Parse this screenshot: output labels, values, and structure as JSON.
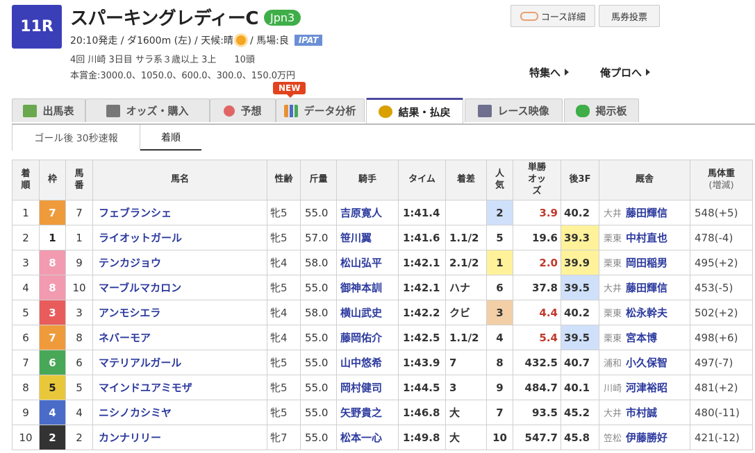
{
  "race": {
    "number": "11R",
    "title": "スパーキングレディーC",
    "grade": "Jpn3",
    "time_course": "20:10発走 / ダ1600m (左) / 天候:晴",
    "track": "/ 馬場:良",
    "ipat": "IPAT",
    "details": "4回 川崎 3日目 サラ系３歳以上 3上　　10頭",
    "prize": "本賞金:3000.0、1050.0、600.0、300.0、150.0万円",
    "weather_icon": "sun-icon"
  },
  "buttons": {
    "course": "コース詳細",
    "baken": "馬券投票"
  },
  "links": {
    "tokushu": "特集へ",
    "orepro": "俺プロへ"
  },
  "new_badge": "NEW",
  "tabs": [
    {
      "label": "出馬表",
      "icon": "table-icon",
      "color": "#6aa84f"
    },
    {
      "label": "オッズ・購入",
      "icon": "odds-icon",
      "color": "#666666"
    },
    {
      "label": "予想",
      "icon": "target-icon",
      "color": "#e06666"
    },
    {
      "label": "データ分析",
      "icon": "chart-icon",
      "color": "#e69138"
    },
    {
      "label": "結果・払戻",
      "icon": "coins-icon",
      "color": "#d9a000"
    },
    {
      "label": "レース映像",
      "icon": "video-icon",
      "color": "#6f6f8f"
    },
    {
      "label": "掲示板",
      "icon": "chat-icon",
      "color": "#3fae49"
    }
  ],
  "subtabs": [
    "ゴール後 30秒速報",
    "着順"
  ],
  "table": {
    "headers": {
      "rank": "着順",
      "waku": "枠",
      "umaban": "馬番",
      "name": "馬名",
      "sex_age": "性齢",
      "weight": "斤量",
      "jockey": "騎手",
      "time": "タイム",
      "margin": "着差",
      "pop": "人気",
      "odds": "単勝オッズ",
      "last3f": "後3F",
      "stable": "厩舎",
      "body": "馬体重",
      "body_sub": "(増減)"
    },
    "rows": [
      {
        "rank": "1",
        "waku": "7",
        "umaban": "7",
        "name": "フェブランシェ",
        "sex_age": "牝5",
        "weight": "55.0",
        "jockey": "吉原寛人",
        "time": "1:41.4",
        "margin": "",
        "pop": "2",
        "odds": "3.9",
        "last3f": "40.2",
        "region": "大井",
        "trainer": "藤田輝信",
        "body": "548(+5)"
      },
      {
        "rank": "2",
        "waku": "1",
        "umaban": "1",
        "name": "ライオットガール",
        "sex_age": "牝5",
        "weight": "57.0",
        "jockey": "笹川翼",
        "time": "1:41.6",
        "margin": "1.1/2",
        "pop": "5",
        "odds": "19.6",
        "last3f": "39.3",
        "region": "栗東",
        "trainer": "中村直也",
        "body": "478(-4)"
      },
      {
        "rank": "3",
        "waku": "8",
        "umaban": "9",
        "name": "テンカジョウ",
        "sex_age": "牝4",
        "weight": "58.0",
        "jockey": "松山弘平",
        "time": "1:42.1",
        "margin": "2.1/2",
        "pop": "1",
        "odds": "2.0",
        "last3f": "39.9",
        "region": "栗東",
        "trainer": "岡田稲男",
        "body": "495(+2)"
      },
      {
        "rank": "4",
        "waku": "8",
        "umaban": "10",
        "name": "マーブルマカロン",
        "sex_age": "牝5",
        "weight": "55.0",
        "jockey": "御神本訓",
        "time": "1:42.1",
        "margin": "ハナ",
        "pop": "6",
        "odds": "37.8",
        "last3f": "39.5",
        "region": "大井",
        "trainer": "藤田輝信",
        "body": "453(-5)"
      },
      {
        "rank": "5",
        "waku": "3",
        "umaban": "3",
        "name": "アンモシエラ",
        "sex_age": "牝4",
        "weight": "58.0",
        "jockey": "横山武史",
        "time": "1:42.2",
        "margin": "クビ",
        "pop": "3",
        "odds": "4.4",
        "last3f": "40.2",
        "region": "栗東",
        "trainer": "松永幹夫",
        "body": "502(+2)"
      },
      {
        "rank": "6",
        "waku": "7",
        "umaban": "8",
        "name": "ネバーモア",
        "sex_age": "牝4",
        "weight": "55.0",
        "jockey": "藤岡佑介",
        "time": "1:42.5",
        "margin": "1.1/2",
        "pop": "4",
        "odds": "5.4",
        "last3f": "39.5",
        "region": "栗東",
        "trainer": "宮本博",
        "body": "498(+6)"
      },
      {
        "rank": "7",
        "waku": "6",
        "umaban": "6",
        "name": "マテリアルガール",
        "sex_age": "牝5",
        "weight": "55.0",
        "jockey": "山中悠希",
        "time": "1:43.9",
        "margin": "7",
        "pop": "8",
        "odds": "432.5",
        "last3f": "40.7",
        "region": "浦和",
        "trainer": "小久保智",
        "body": "497(-7)"
      },
      {
        "rank": "8",
        "waku": "5",
        "umaban": "5",
        "name": "マインドユアミモザ",
        "sex_age": "牝5",
        "weight": "55.0",
        "jockey": "岡村健司",
        "time": "1:44.5",
        "margin": "3",
        "pop": "9",
        "odds": "484.7",
        "last3f": "40.1",
        "region": "川崎",
        "trainer": "河津裕昭",
        "body": "481(+2)"
      },
      {
        "rank": "9",
        "waku": "4",
        "umaban": "4",
        "name": "ニシノカシミヤ",
        "sex_age": "牝5",
        "weight": "55.0",
        "jockey": "矢野貴之",
        "time": "1:46.8",
        "margin": "大",
        "pop": "7",
        "odds": "93.5",
        "last3f": "45.2",
        "region": "大井",
        "trainer": "市村誠",
        "body": "480(-11)"
      },
      {
        "rank": "10",
        "waku": "2",
        "umaban": "2",
        "name": "カンナリリー",
        "sex_age": "牝7",
        "weight": "55.0",
        "jockey": "松本一心",
        "time": "1:49.8",
        "margin": "大",
        "pop": "10",
        "odds": "547.7",
        "last3f": "45.8",
        "region": "笠松",
        "trainer": "伊藤勝好",
        "body": "421(-12)"
      }
    ]
  },
  "waku_colors": {
    "1": {
      "bg": "#ffffff",
      "fg": "#222222"
    },
    "2": {
      "bg": "#333333",
      "fg": "#ffffff"
    },
    "3": {
      "bg": "#e85c5c",
      "fg": "#ffffff"
    },
    "4": {
      "bg": "#4a6cc8",
      "fg": "#ffffff"
    },
    "5": {
      "bg": "#e8c83a",
      "fg": "#222222"
    },
    "6": {
      "bg": "#48a857",
      "fg": "#ffffff"
    },
    "7": {
      "bg": "#ef9b3c",
      "fg": "#ffffff"
    },
    "8": {
      "bg": "#f29ab0",
      "fg": "#ffffff"
    }
  },
  "highlight_colors": {
    "pop1": "#fff29a",
    "pop2": "#cfe0fb",
    "pop3": "#f3cfa8",
    "f3_1": "#fff29a",
    "f3_2": "#cfe0fb",
    "odds_top": "#c0392b"
  }
}
